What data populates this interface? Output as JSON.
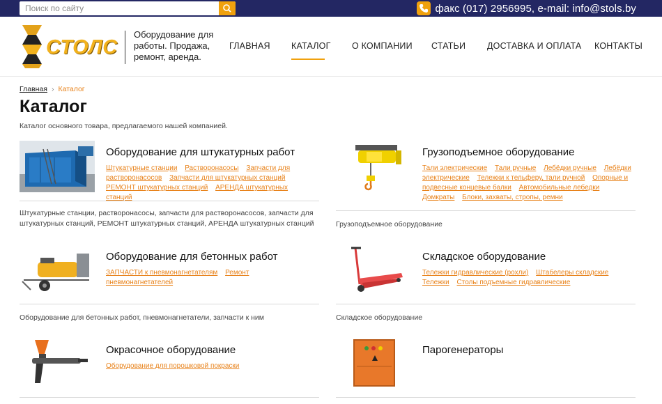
{
  "topbar": {
    "search_placeholder": "Поиск по сайту",
    "contact": "факс (017) 2956995, e-mail: info@stols.by"
  },
  "header": {
    "logo_text": "СТОЛС",
    "tagline": "Оборудование для работы. Продажа, ремонт, аренда.",
    "nav": [
      "ГЛАВНАЯ",
      "КАТАЛОГ",
      "О КОМПАНИИ",
      "СТАТЬИ",
      "ДОСТАВКА И ОПЛАТА",
      "КОНТАКТЫ"
    ],
    "active_nav": "КАТАЛОГ"
  },
  "breadcrumb": {
    "home": "Главная",
    "separator": "›",
    "current": "Каталог"
  },
  "page": {
    "title": "Каталог",
    "intro": "Каталог основного товара, предлагаемого нашей компанией."
  },
  "categories": [
    {
      "title": "Оборудование для штукатурных работ",
      "links": [
        "Штукатурные станции",
        "Растворонасосы",
        "Запчасти для растворонасосов",
        "Запчасти для штукатурных станций",
        "РЕМОНТ штукатурных станций",
        "АРЕНДА штукатурных станций"
      ],
      "description": "Штукатурные станции, растворонасосы, запчасти для растворонасосов, запчасти для штукатурных станций, РЕМОНТ штукатурных станций, АРЕНДА штукатурных станций",
      "image": "plaster-station-image"
    },
    {
      "title": "Грузоподъемное оборудование",
      "links": [
        "Тали электрические",
        "Тали ручные",
        "Лебёдки ручные",
        "Лебёдки электрические",
        "Тележки к тельферу, тали ручной",
        "Опорные и подвесные концевые балки",
        "Автомобильные лебедки",
        "Домкраты",
        "Блоки, захваты, стропы, ремни"
      ],
      "description": "Грузоподъемное оборудование",
      "image": "electric-hoist-image"
    },
    {
      "title": "Оборудование для бетонных работ",
      "links": [
        "ЗАПЧАСТИ к пневмонагнетателям",
        "Ремонт пневмонагнетателей"
      ],
      "description": "Оборудование для бетонных работ, пневмонагнетатели, запчасти к ним",
      "image": "concrete-pump-image"
    },
    {
      "title": "Складское оборудование",
      "links": [
        "Тележки гидравлические (рохли)",
        "Штабелеры складские",
        "Тележки",
        "Столы подъемные гидравлические"
      ],
      "description": "Складское оборудование",
      "image": "pallet-truck-image"
    },
    {
      "title": "Окрасочное оборудование",
      "links": [
        "Оборудование для порошковой покраски"
      ],
      "description": "",
      "image": "spray-gun-image"
    },
    {
      "title": "Парогенераторы",
      "links": [],
      "description": "",
      "image": "steam-generator-image"
    }
  ],
  "colors": {
    "topbar": "#232763",
    "accent": "#f0a10d",
    "link": "#e8821a"
  }
}
